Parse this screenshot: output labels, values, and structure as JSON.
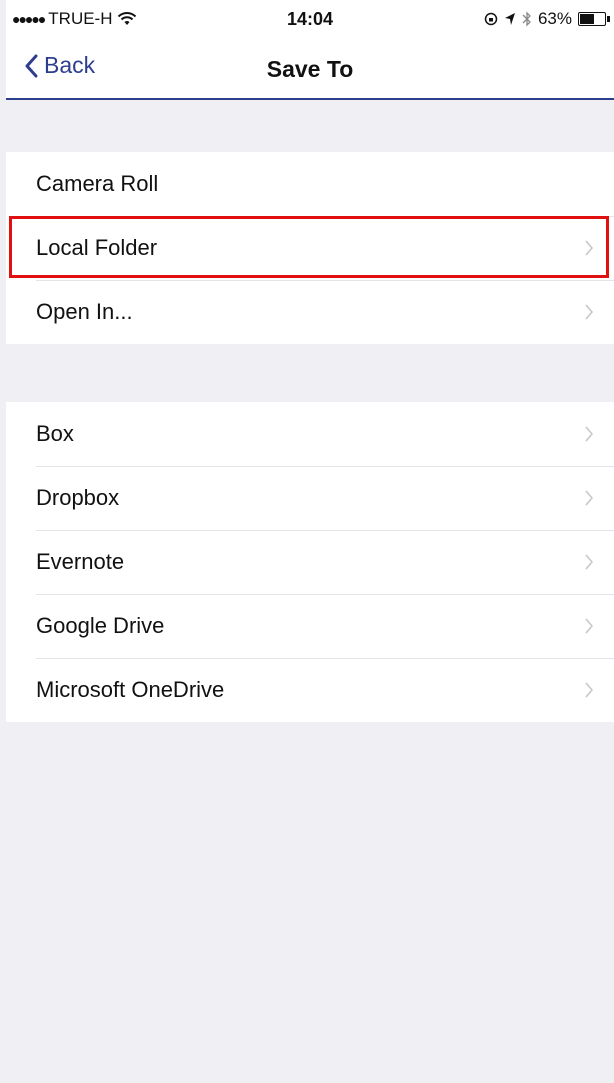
{
  "status_bar": {
    "signal": "●●●●●",
    "carrier": "TRUE-H",
    "time": "14:04",
    "battery_percent": "63%",
    "battery_level": 0.63,
    "icons": [
      "wifi-icon",
      "lock-rotation-icon",
      "location-icon",
      "bluetooth-icon",
      "battery-icon"
    ]
  },
  "nav": {
    "back_label": "Back",
    "title": "Save To",
    "accent_color": "#2d3e8f"
  },
  "groups": [
    {
      "items": [
        {
          "label": "Camera Roll",
          "chevron": false
        },
        {
          "label": "Local Folder",
          "chevron": true,
          "highlighted": true
        },
        {
          "label": "Open In...",
          "chevron": true
        }
      ]
    },
    {
      "items": [
        {
          "label": "Box",
          "chevron": true
        },
        {
          "label": "Dropbox",
          "chevron": true
        },
        {
          "label": "Evernote",
          "chevron": true
        },
        {
          "label": "Google Drive",
          "chevron": true
        },
        {
          "label": "Microsoft OneDrive",
          "chevron": true
        }
      ]
    }
  ],
  "highlight_color": "#e01010"
}
